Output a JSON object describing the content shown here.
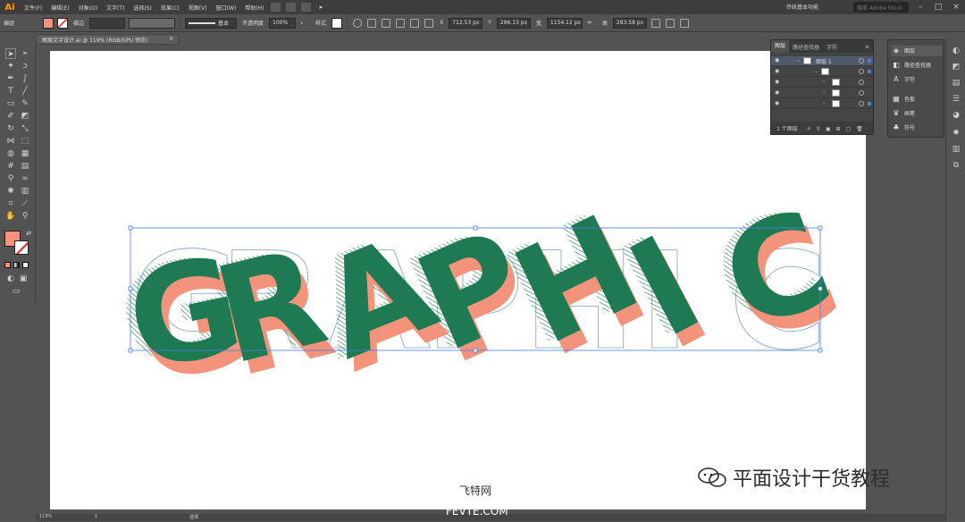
{
  "app": {
    "logo": "Ai"
  },
  "menu": [
    "文件(F)",
    "编辑(E)",
    "对象(O)",
    "文字(T)",
    "选择(S)",
    "效果(C)",
    "视图(V)",
    "窗口(W)",
    "帮助(H)"
  ],
  "workspace": "传统基本功能",
  "search_placeholder": "搜索 Adobe Stock",
  "control_bar": {
    "selection_label": "编组",
    "stroke_label": "描边",
    "stroke_style": "基本",
    "opacity_label": "不透明度",
    "opacity_value": "100%",
    "style_label": "样式",
    "x_label": "X",
    "x_value": "712.53 px",
    "y_label": "Y",
    "y_value": "296.13 px",
    "w_label": "宽",
    "w_value": "1154.12 px",
    "h_label": "高",
    "h_value": "283.58 px",
    "fill_color": "#f4937c"
  },
  "document_tab": {
    "title": "图案文字设计.ai @ 119% (RGB/GPU 预览)",
    "close": "×"
  },
  "artwork": {
    "word": "GRAPHIC",
    "letters": [
      "G",
      "R",
      "A",
      "P",
      "H",
      "I",
      "C"
    ],
    "green": "#1e7a52",
    "salmon": "#f4937c",
    "outline": "#7aa0c8"
  },
  "layers_panel": {
    "tabs": [
      "图层",
      "路径查找器",
      "字符"
    ],
    "layer_name": "图层 1",
    "footer": "1 个图层"
  },
  "right_panel": {
    "items": [
      {
        "icon": "layers-icon",
        "label": "图层"
      },
      {
        "icon": "pathfinder-icon",
        "label": "路径查找器"
      },
      {
        "icon": "character-icon",
        "label": "字符"
      },
      {
        "icon": "swatches-icon",
        "label": "色板"
      },
      {
        "icon": "brushes-icon",
        "label": "画笔"
      },
      {
        "icon": "symbols-icon",
        "label": "符号"
      }
    ]
  },
  "status_bar": {
    "zoom": "119%",
    "page": "1",
    "mode": "选择"
  },
  "watermark": {
    "brand": "平面设计干货教程",
    "site_cn": "飞特网",
    "site_en": "FEVTE.COM"
  }
}
